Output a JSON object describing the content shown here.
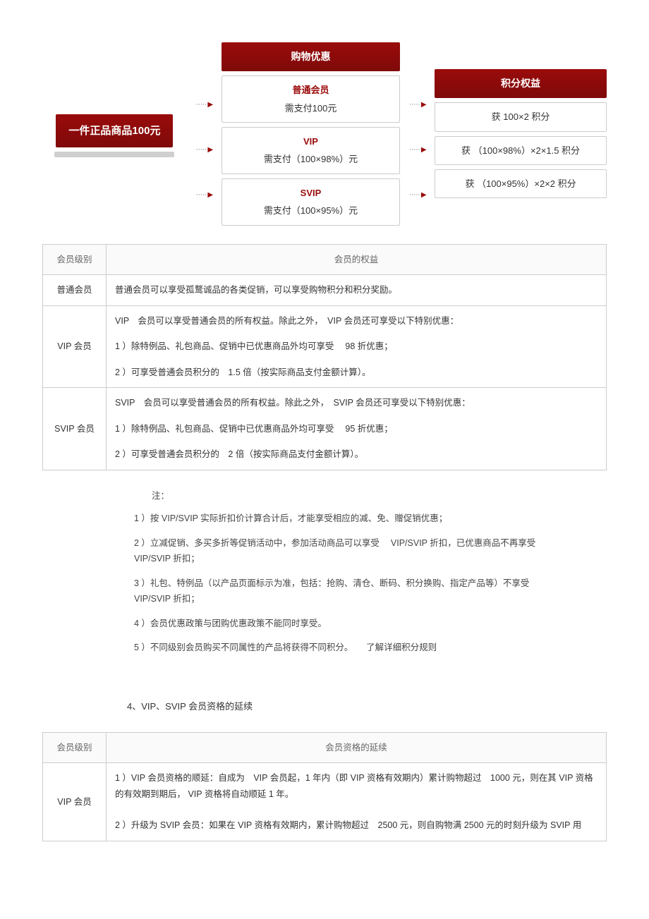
{
  "diagram": {
    "product_label": "一件正品商品100元",
    "header_discount": "购物优惠",
    "header_points": "积分权益",
    "tiers": [
      {
        "name": "普通会员",
        "pay": "需支付100元",
        "points": "获 100×2 积分"
      },
      {
        "name": "VIP",
        "pay": "需支付（100×98%）元",
        "points": "获 （100×98%）×2×1.5 积分"
      },
      {
        "name": "SVIP",
        "pay": "需支付（100×95%）元",
        "points": "获 （100×95%）×2×2 积分"
      }
    ]
  },
  "benefits_table": {
    "col_level": "会员级别",
    "col_rights": "会员的权益",
    "rows": [
      {
        "level": "普通会员",
        "lines": [
          "普通会员可以享受孤鹜诚品的各类促销，可以享受购物积分和积分奖励。"
        ]
      },
      {
        "level": "VIP 会员",
        "lines": [
          "VIP　会员可以享受普通会员的所有权益。除此之外，　VIP 会员还可享受以下特别优惠：",
          "1 ）除特例品、礼包商品、促销中已优惠商品外均可享受　 98 折优惠；",
          "2 ）可享受普通会员积分的　1.5 倍（按实际商品支付金额计算）。"
        ]
      },
      {
        "level": "SVIP 会员",
        "lines": [
          "SVIP　会员可以享受普通会员的所有权益。除此之外，　SVIP 会员还可享受以下特别优惠：",
          "1 ）除特例品、礼包商品、促销中已优惠商品外均可享受　 95 折优惠；",
          "2 ）可享受普通会员积分的　2 倍（按实际商品支付金额计算）。"
        ]
      }
    ]
  },
  "notes": {
    "title": "注：",
    "items": [
      "1 ）按 VIP/SVIP 实际折扣价计算合计后，才能享受相应的减、免、赠促销优惠；",
      "2 ）立减促销、多买多折等促销活动中，参加活动商品可以享受　 VIP/SVIP 折扣，已优惠商品不再享受　VIP/SVIP 折扣；",
      "3 ）礼包、特例品（以产品页面标示为准，包括：抢购、清仓、断码、积分换购、指定产品等）不享受　　VIP/SVIP 折扣；",
      "4 ）会员优惠政策与团购优惠政策不能同时享受。",
      "5 ）不同级别会员购买不同属性的产品将获得不同积分。　　了解详细积分规则"
    ]
  },
  "section4_title": "4、VIP、SVIP 会员资格的延续",
  "renew_table": {
    "col_level": "会员级别",
    "col_rights": "会员资格的延续",
    "rows": [
      {
        "level": "VIP 会员",
        "lines": [
          "1 ）VIP 会员资格的顺延：自成为　VIP 会员起，1 年内（即 VIP 资格有效期内）累计购物超过　1000 元，则在其 VIP 资格的有效期到期后， VIP 资格将自动顺延 1 年。",
          "2 ）升级为 SVIP 会员：如果在 VIP 资格有效期内，累计购物超过　2500 元，则自购物满 2500 元的时刻升级为 SVIP 用"
        ]
      }
    ]
  }
}
